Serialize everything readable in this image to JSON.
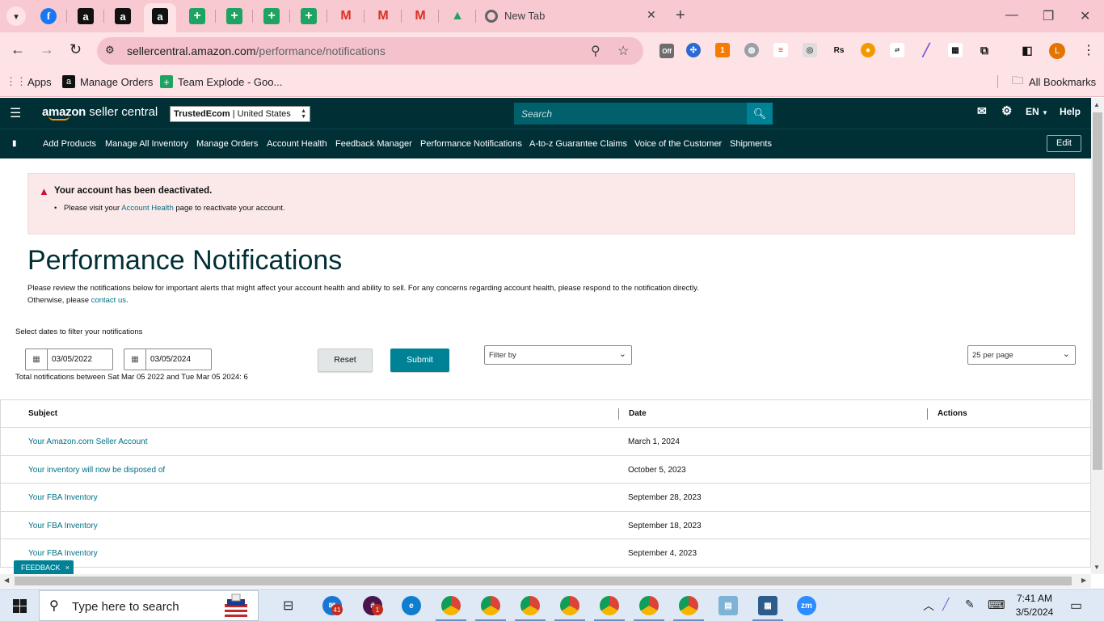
{
  "browser": {
    "active_tab_title": "New Tab",
    "url_host": "sellercentral.amazon.com",
    "url_path": "/performance/notifications",
    "bookmarks": [
      "Apps",
      "Manage Orders",
      "Team Explode - Goo..."
    ],
    "all_bookmarks_label": "All Bookmarks",
    "profile_initial": "L",
    "ext_badge": "1",
    "ext_off_label": "Off"
  },
  "header": {
    "logo_text": "amazon",
    "logo_suffix": " seller central",
    "store_name": "TrustedEcom",
    "store_region": "United States",
    "search_placeholder": "Search",
    "lang": "EN",
    "help": "Help"
  },
  "nav": {
    "items": [
      "Add Products",
      "Manage All Inventory",
      "Manage Orders",
      "Account Health",
      "Feedback Manager",
      "Performance Notifications",
      "A-to-z Guarantee Claims",
      "Voice of the Customer",
      "Shipments"
    ],
    "edit_label": "Edit"
  },
  "alert": {
    "title": "Your account has been deactivated.",
    "msg_before": "Please visit your ",
    "msg_link": "Account Health",
    "msg_after": " page to reactivate your account."
  },
  "page": {
    "title": "Performance Notifications",
    "desc_before": "Please review the notifications below for important alerts that might affect your account health and ability to sell. For any concerns regarding account health, please respond to the notification directly. Otherwise, please ",
    "desc_link": "contact us",
    "desc_after": "."
  },
  "filters": {
    "label": "Select dates to filter your notifications",
    "start_date": "03/05/2022",
    "end_date": "03/05/2024",
    "reset_label": "Reset",
    "submit_label": "Submit",
    "filter_by": "Filter by",
    "per_page": "25 per page",
    "total_text": "Total notifications between Sat Mar 05 2022 and Tue Mar 05 2024: 6"
  },
  "table": {
    "columns": [
      "Subject",
      "Date",
      "Actions"
    ],
    "rows": [
      {
        "subject": "Your Amazon.com Seller Account",
        "date": "March 1, 2024"
      },
      {
        "subject": "Your inventory will now be disposed of",
        "date": "October 5, 2023"
      },
      {
        "subject": "Your FBA Inventory",
        "date": "September 28, 2023"
      },
      {
        "subject": "Your FBA Inventory",
        "date": "September 18, 2023"
      },
      {
        "subject": "Your FBA Inventory",
        "date": "September 4, 2023"
      }
    ]
  },
  "feedback": {
    "label": "FEEDBACK",
    "close": "×"
  },
  "taskbar": {
    "search_placeholder": "Type here to search",
    "time": "7:41 AM",
    "date": "3/5/2024",
    "mail_badge": "41",
    "slack_badge": "1",
    "zoom_label": "zm"
  },
  "colors": {
    "header_bg": "#002f36",
    "teal_button": "#008296",
    "link": "#007185",
    "alert_bg": "#fbe9e9",
    "chrome_pink": "#f8c9d0"
  }
}
